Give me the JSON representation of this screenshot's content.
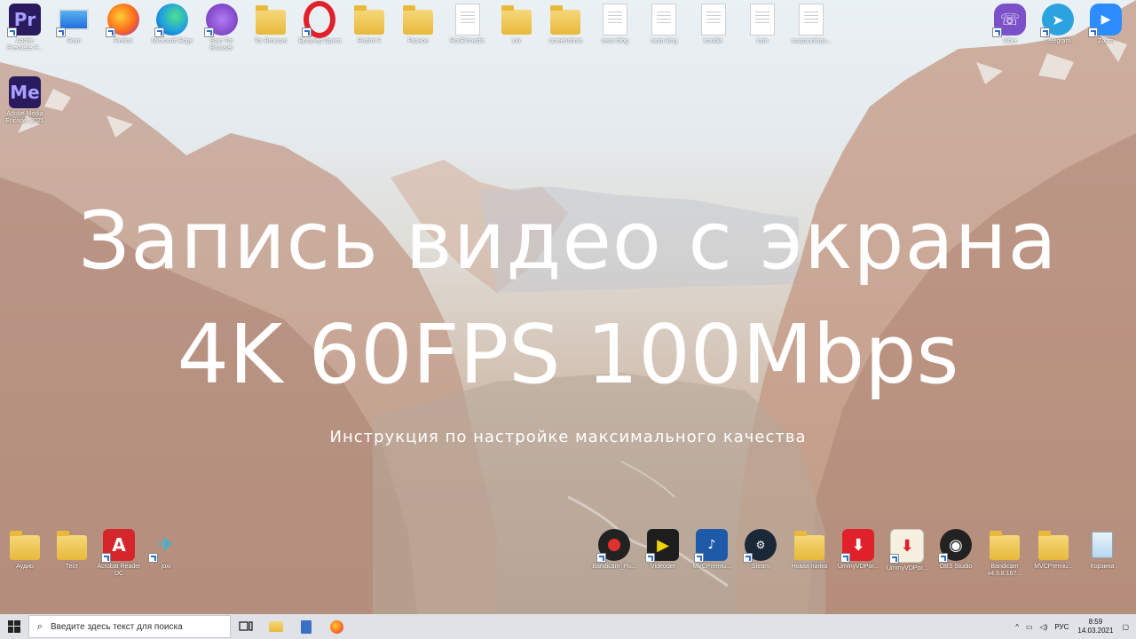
{
  "desktop": {
    "top_icons": [
      {
        "label": "Adobe Premiere P...",
        "kind": "pr"
      },
      {
        "label": "Sean",
        "kind": "pc"
      },
      {
        "label": "Firefox",
        "kind": "firefox"
      },
      {
        "label": "Microsoft Edge",
        "kind": "edge"
      },
      {
        "label": "Start Tor Browser",
        "kind": "tor"
      },
      {
        "label": "Tor Browser",
        "kind": "folder"
      },
      {
        "label": "Браузер Opera",
        "kind": "opera"
      },
      {
        "label": "Redmi 9",
        "kind": "folder"
      },
      {
        "label": "Разное",
        "kind": "folder"
      },
      {
        "label": "RorEXmedic",
        "kind": "doc"
      },
      {
        "label": "xxx",
        "kind": "folder"
      },
      {
        "label": "screenshots",
        "kind": "folder"
      },
      {
        "label": "sean blog",
        "kind": "doc"
      },
      {
        "label": "sean king",
        "kind": "doc"
      },
      {
        "label": "trouble",
        "kind": "doc"
      },
      {
        "label": "icon",
        "kind": "doc"
      },
      {
        "label": "ssupanoinpu...",
        "kind": "doc"
      }
    ],
    "media_encoder_icon": {
      "label": "Adobe Media Encoder 2021"
    },
    "top_right_icons": [
      {
        "label": "Viber",
        "kind": "viber"
      },
      {
        "label": "Telegram",
        "kind": "telegram"
      },
      {
        "label": "Zoom",
        "kind": "zoom"
      }
    ],
    "bottom_left_icons": [
      {
        "label": "Аудио",
        "kind": "folder"
      },
      {
        "label": "Тест",
        "kind": "folder"
      },
      {
        "label": "Acrobat Reader DC",
        "kind": "acrobat"
      },
      {
        "label": "joxi",
        "kind": "joxi"
      }
    ],
    "bottom_right_icons": [
      {
        "label": "Bandicam_Po...",
        "kind": "bandicam"
      },
      {
        "label": "Videoder",
        "kind": "videoder"
      },
      {
        "label": "MVCPremiu...",
        "kind": "mvc"
      },
      {
        "label": "Steam",
        "kind": "steam"
      },
      {
        "label": "Новая папка",
        "kind": "folder"
      },
      {
        "label": "UmmyVDPor...",
        "kind": "ummy"
      },
      {
        "label": "UmmyVDPor...",
        "kind": "ummy2"
      },
      {
        "label": "OBS Studio",
        "kind": "obs"
      },
      {
        "label": "Bandicam v4.5.8.167...",
        "kind": "folder"
      },
      {
        "label": "MVCPremiu...",
        "kind": "folder"
      },
      {
        "label": "Корзина",
        "kind": "bin"
      }
    ]
  },
  "overlay": {
    "line1": "Запись видео с экрана",
    "line2": "4K 60FPS 100Mbps",
    "subtitle": "Инструкция по настройке максимального качества"
  },
  "taskbar": {
    "search_placeholder": "Введите здесь текст для поиска",
    "language": "РУС",
    "time": "8:59",
    "date": "14.03.2021"
  },
  "colors": {
    "premiere": "#2a1a5e",
    "media_encoder": "#2a1a5e",
    "accent_blue": "#1f6fe0"
  }
}
